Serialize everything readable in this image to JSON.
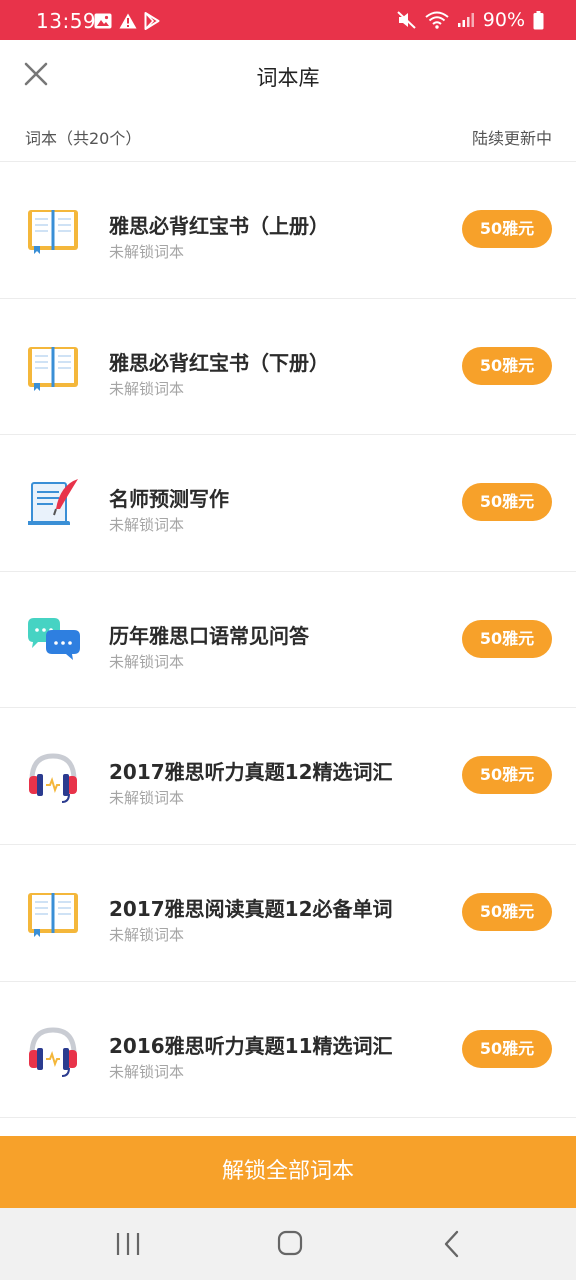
{
  "status": {
    "time": "13:59",
    "battery": "90%"
  },
  "header": {
    "title": "词本库"
  },
  "subheader": {
    "count_label": "词本（共20个）",
    "update_label": "陆续更新中"
  },
  "items": [
    {
      "icon": "book-icon",
      "title": "雅思必背红宝书（上册）",
      "status": "未解锁词本",
      "price": "50雅元"
    },
    {
      "icon": "book-icon",
      "title": "雅思必背红宝书（下册）",
      "status": "未解锁词本",
      "price": "50雅元"
    },
    {
      "icon": "quill-document-icon",
      "title": "名师预测写作",
      "status": "未解锁词本",
      "price": "50雅元"
    },
    {
      "icon": "chat-bubbles-icon",
      "title": "历年雅思口语常见问答",
      "status": "未解锁词本",
      "price": "50雅元"
    },
    {
      "icon": "headphones-icon",
      "title": "2017雅思听力真题12精选词汇",
      "status": "未解锁词本",
      "price": "50雅元"
    },
    {
      "icon": "book-icon",
      "title": "2017雅思阅读真题12必备单词",
      "status": "未解锁词本",
      "price": "50雅元"
    },
    {
      "icon": "headphones-icon",
      "title": "2016雅思听力真题11精选词汇",
      "status": "未解锁词本",
      "price": "50雅元"
    }
  ],
  "footer": {
    "unlock_all_label": "解锁全部词本"
  },
  "colors": {
    "accent": "#f7a12a",
    "status_bar": "#e8334a"
  }
}
